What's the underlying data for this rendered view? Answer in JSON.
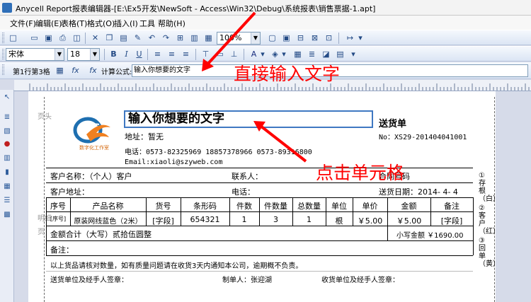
{
  "window": {
    "title": "Anycell Report报表编辑器-[E:\\Ex5开发\\NewSoft - Access\\Win32\\Debug\\系统报表\\销售票据-1.apt]"
  },
  "menu": [
    "文件(F)",
    "编辑(E)",
    "表格(T)",
    "格式(O)",
    "插入(I)",
    "工具",
    "帮助(H)"
  ],
  "toolbar": {
    "zoom": "100%",
    "font_name": "宋体",
    "font_size": "18",
    "bold": "B",
    "italic": "I",
    "underline": "U",
    "font_color": "A"
  },
  "formula_bar": {
    "cell_ref": "第1行第3格",
    "fx_label": "计算公式:",
    "value": "输入你想要的文字"
  },
  "sheet": {
    "page_header_label": "页头",
    "detail_label": "明细",
    "footer_label": "页",
    "title_cell": "输入你想要的文字",
    "doc_title": "送货单",
    "address": "地址：暂无",
    "phone": "电话：0573-82325969 18857378966 0573-89316800",
    "email": "Email:xiaoli@szyweb.com",
    "doc_no": "No：XS29-201404041001",
    "logo_text": "数字化工作室",
    "customer_name": "客户名称：（个人）客户",
    "contact": "联系人：",
    "contract_no": "合同号码",
    "customer_addr": "客户地址：",
    "tel": "电话：",
    "delivery_date": "送货日期：2014- 4- 4",
    "headers": [
      "序号",
      "产品名称",
      "货号",
      "条形码",
      "件数",
      "件数量",
      "总数量",
      "单位",
      "单价",
      "金额",
      "备注"
    ],
    "row": [
      "[序号]",
      "原装网线蓝色（2米）",
      "[字段]",
      "654321",
      "1",
      "3",
      "1",
      "根",
      "￥5.00",
      "￥5.00",
      "[字段]"
    ],
    "total_caps": "金额合计（大写）贰拾伍圆整",
    "total_small": "小写金额 ￥1690.00",
    "remark": "备注：",
    "notice": "以上货品请核对数量，如有质量问题请在收货3天内通知本公司，逾期概不负责。",
    "sign_sender": "送货单位及经手人签章：",
    "maker": "制单人：张迎湖",
    "sign_receiver": "收货单位及经手人签章：",
    "side_copies": [
      "①存根（白）",
      "②客户（红）",
      "③回单（黄）"
    ]
  },
  "annotations": {
    "top": "直接输入文字",
    "bottom": "点击单元格",
    "color": "#ff0000"
  }
}
